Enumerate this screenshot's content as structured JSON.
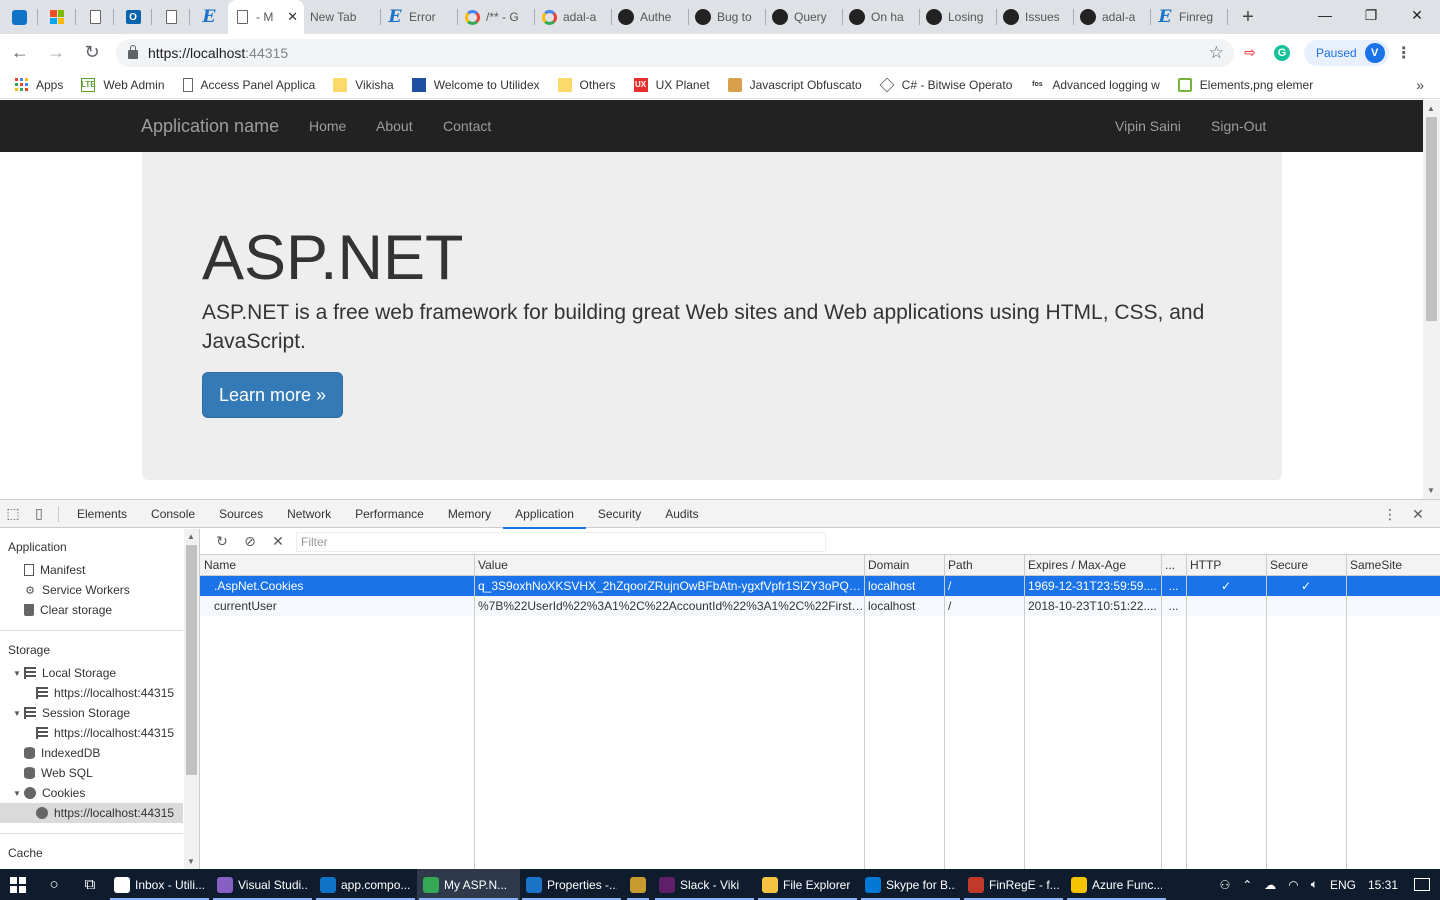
{
  "browser": {
    "tabs": [
      {
        "label": "",
        "icon": "vscode-icon"
      },
      {
        "label": "",
        "icon": "microsoft-icon"
      },
      {
        "label": "",
        "icon": "page-icon"
      },
      {
        "label": "",
        "icon": "outlook-icon"
      },
      {
        "label": "",
        "icon": "page-icon"
      },
      {
        "label": "",
        "icon": "edge-icon"
      },
      {
        "label": "- M",
        "icon": "page-icon",
        "active": true
      },
      {
        "label": "New Tab",
        "icon": ""
      },
      {
        "label": "Error",
        "icon": "edge-icon"
      },
      {
        "label": "/** - G",
        "icon": "google-icon"
      },
      {
        "label": "adal-a",
        "icon": "google-icon"
      },
      {
        "label": "Authe",
        "icon": "github-icon"
      },
      {
        "label": "Bug to",
        "icon": "github-icon"
      },
      {
        "label": "Query",
        "icon": "github-icon"
      },
      {
        "label": "On ha",
        "icon": "github-icon"
      },
      {
        "label": "Losing",
        "icon": "github-icon"
      },
      {
        "label": "Issues",
        "icon": "github-icon"
      },
      {
        "label": "adal-a",
        "icon": "github-icon"
      },
      {
        "label": "Finreg",
        "icon": "edge-icon"
      }
    ],
    "new_tab": "+",
    "window_controls": {
      "minimize": "—",
      "restore": "❐",
      "close": "✕"
    },
    "url_host": "https://localhost",
    "url_port": ":44315",
    "profile_status": "Paused",
    "profile_initial": "V",
    "bookmarks": [
      {
        "label": "Apps",
        "icon": "apps-icon"
      },
      {
        "label": "Web Admin",
        "icon": "lte-icon",
        "text": "LTE"
      },
      {
        "label": "Access Panel Applica",
        "icon": "page-icon"
      },
      {
        "label": "Vikisha",
        "icon": "folder-icon"
      },
      {
        "label": "Welcome to Utilidex",
        "icon": "utilidex-icon"
      },
      {
        "label": "Others",
        "icon": "folder-icon"
      },
      {
        "label": "UX Planet",
        "icon": "ux-icon",
        "text": "UX"
      },
      {
        "label": "Javascript Obfuscato",
        "icon": "lock-icon"
      },
      {
        "label": "C# - Bitwise Operato",
        "icon": "diamond-icon"
      },
      {
        "label": "Advanced logging w",
        "icon": "fos-icon",
        "text": "fos"
      },
      {
        "label": "Elements,png elemer",
        "icon": "elements-icon"
      }
    ],
    "bookmarks_more": "»"
  },
  "site": {
    "brand": "Application name",
    "nav": [
      "Home",
      "About",
      "Contact"
    ],
    "user": "Vipin Saini",
    "signout": "Sign-Out",
    "hero_title": "ASP.NET",
    "hero_text": "ASP.NET is a free web framework for building great Web sites and Web applications using HTML, CSS, and JavaScript.",
    "hero_button": "Learn more »"
  },
  "devtools": {
    "tabs": [
      "Elements",
      "Console",
      "Sources",
      "Network",
      "Performance",
      "Memory",
      "Application",
      "Security",
      "Audits"
    ],
    "active_tab": "Application",
    "sidebar": {
      "application_header": "Application",
      "application_items": [
        "Manifest",
        "Service Workers",
        "Clear storage"
      ],
      "storage_header": "Storage",
      "local_storage": "Local Storage",
      "local_storage_origin": "https://localhost:44315",
      "session_storage": "Session Storage",
      "session_storage_origin": "https://localhost:44315",
      "indexeddb": "IndexedDB",
      "websql": "Web SQL",
      "cookies": "Cookies",
      "cookies_origin": "https://localhost:44315",
      "cache_header": "Cache"
    },
    "filter_placeholder": "Filter",
    "columns": [
      "Name",
      "Value",
      "Domain",
      "Path",
      "Expires / Max-Age",
      "...",
      "HTTP",
      "Secure",
      "SameSite"
    ],
    "cookies": [
      {
        "name": ".AspNet.Cookies",
        "value": "q_3S9oxhNoXKSVHX_2hZqoorZRujnOwBFbAtn-ygxfVpfr1SlZY3oPQpA...",
        "domain": "localhost",
        "path": "/",
        "expires": "1969-12-31T23:59:59....",
        "size": "...",
        "http": "✓",
        "secure": "✓",
        "samesite": ""
      },
      {
        "name": "currentUser",
        "value": "%7B%22UserId%22%3A1%2C%22AccountId%22%3A1%2C%22FirstNa...",
        "domain": "localhost",
        "path": "/",
        "expires": "2018-10-23T10:51:22....",
        "size": "...",
        "http": "",
        "secure": "",
        "samesite": ""
      }
    ]
  },
  "taskbar": {
    "apps": [
      {
        "label": "Inbox - Utili...",
        "color": "#ffffff"
      },
      {
        "label": "Visual Studi...",
        "color": "#865fc5"
      },
      {
        "label": "app.compo...",
        "color": "#0f74c8"
      },
      {
        "label": "My ASP.N...",
        "color": "#34a853",
        "active": true
      },
      {
        "label": "Properties -...",
        "color": "#1a73c7"
      },
      {
        "label": "Slack - Viki",
        "color": "#611f69"
      },
      {
        "label": "File Explorer",
        "color": "#f5c342"
      },
      {
        "label": "Skype for B...",
        "color": "#0078d4"
      },
      {
        "label": "FinRegE - f...",
        "color": "#c0392b"
      },
      {
        "label": "Azure Func...",
        "color": "#f7c200"
      }
    ],
    "language": "ENG",
    "time": "15:31"
  }
}
